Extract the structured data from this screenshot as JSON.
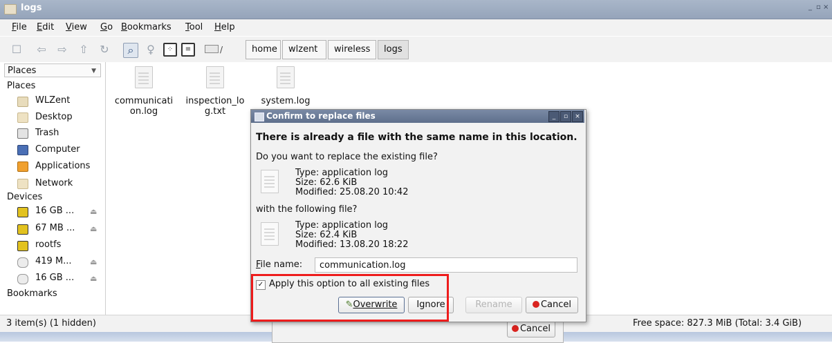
{
  "window": {
    "title": "logs",
    "controls": [
      "_",
      "▫",
      "×"
    ]
  },
  "menu": [
    "File",
    "Edit",
    "View",
    "Go",
    "Bookmarks",
    "Tool",
    "Help"
  ],
  "toolbar": {
    "drive_label": "/",
    "breadcrumbs": [
      "home",
      "wlzent",
      "wireless",
      "logs"
    ]
  },
  "sidebar": {
    "selector": "Places",
    "places_header": "Places",
    "places": [
      "WLZent",
      "Desktop",
      "Trash",
      "Computer",
      "Applications",
      "Network"
    ],
    "devices_header": "Devices",
    "devices": [
      "16 GB ...",
      "67 MB ...",
      "rootfs",
      "419 M...",
      "16 GB ..."
    ],
    "bookmarks_header": "Bookmarks"
  },
  "files": [
    {
      "line1": "communicati",
      "line2": "on.log"
    },
    {
      "line1": "inspection_lo",
      "line2": "g.txt"
    },
    {
      "line1": "system.log",
      "line2": ""
    }
  ],
  "dialog": {
    "title": "Confirm to replace files",
    "heading": "There is already a file with the same name in this location.",
    "question": "Do you want to replace the existing file?",
    "existing": {
      "type": "Type: application log",
      "size": "Size: 62.6 KiB",
      "modified": "Modified: 25.08.20 10:42"
    },
    "with_text": "with the following file?",
    "new": {
      "type": "Type: application log",
      "size": "Size: 62.4 KiB",
      "modified": "Modified: 13.08.20 18:22"
    },
    "file_name_label": "File name:",
    "file_name_value": "communication.log",
    "apply_all": "Apply this option to all existing files",
    "buttons": {
      "overwrite": "Overwrite",
      "ignore": "Ignore",
      "rename": "Rename",
      "cancel": "Cancel"
    }
  },
  "background_dialog": {
    "cancel": "Cancel"
  },
  "status": {
    "left": "3 item(s) (1 hidden)",
    "right": "Free space: 827.3 MiB (Total: 3.4 GiB)"
  },
  "colors": {
    "highlight": "#ee1c1c",
    "title_bar": "#9fadc2",
    "dialog_title": "#6b7c98"
  }
}
